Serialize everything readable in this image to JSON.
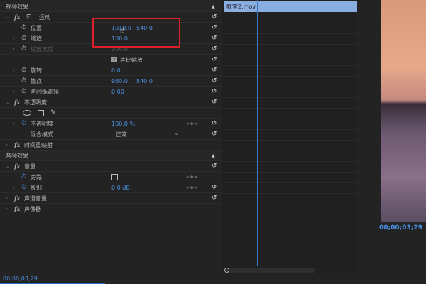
{
  "video_effects": {
    "title": "视频效果",
    "motion": {
      "name": "运动",
      "position": {
        "label": "位置",
        "x": "1010.0",
        "y": "540.0"
      },
      "scale": {
        "label": "缩放",
        "value": "100.0"
      },
      "scale_width": {
        "label": "缩放宽度",
        "value": "100.0"
      },
      "uniform_scale": {
        "label": "等比缩放",
        "checked": true
      },
      "rotation": {
        "label": "旋转",
        "value": "0.0"
      },
      "anchor": {
        "label": "锚点",
        "x": "960.0",
        "y": "540.0"
      },
      "anti_flicker": {
        "label": "防闪烁滤镜",
        "value": "0.00"
      }
    },
    "opacity": {
      "name": "不透明度",
      "opacity": {
        "label": "不透明度",
        "value": "100.0 %"
      },
      "blend_mode": {
        "label": "混合模式",
        "value": "正常"
      }
    },
    "time_remap": {
      "name": "时间重映射"
    }
  },
  "audio_effects": {
    "title": "音频效果",
    "volume": {
      "name": "音量",
      "bypass": {
        "label": "旁路",
        "checked": false
      },
      "level": {
        "label": "级别",
        "value": "0.0 dB"
      }
    },
    "channel_volume": {
      "name": "声道音量"
    },
    "panner": {
      "name": "声像器"
    }
  },
  "timeline": {
    "clip_name": "教堂2.mov"
  },
  "timecode_bottom": "00;00;03;29",
  "timecode_program": "00;00;03;29",
  "colors": {
    "accent": "#4a90e2",
    "highlight": "#e0202a"
  }
}
